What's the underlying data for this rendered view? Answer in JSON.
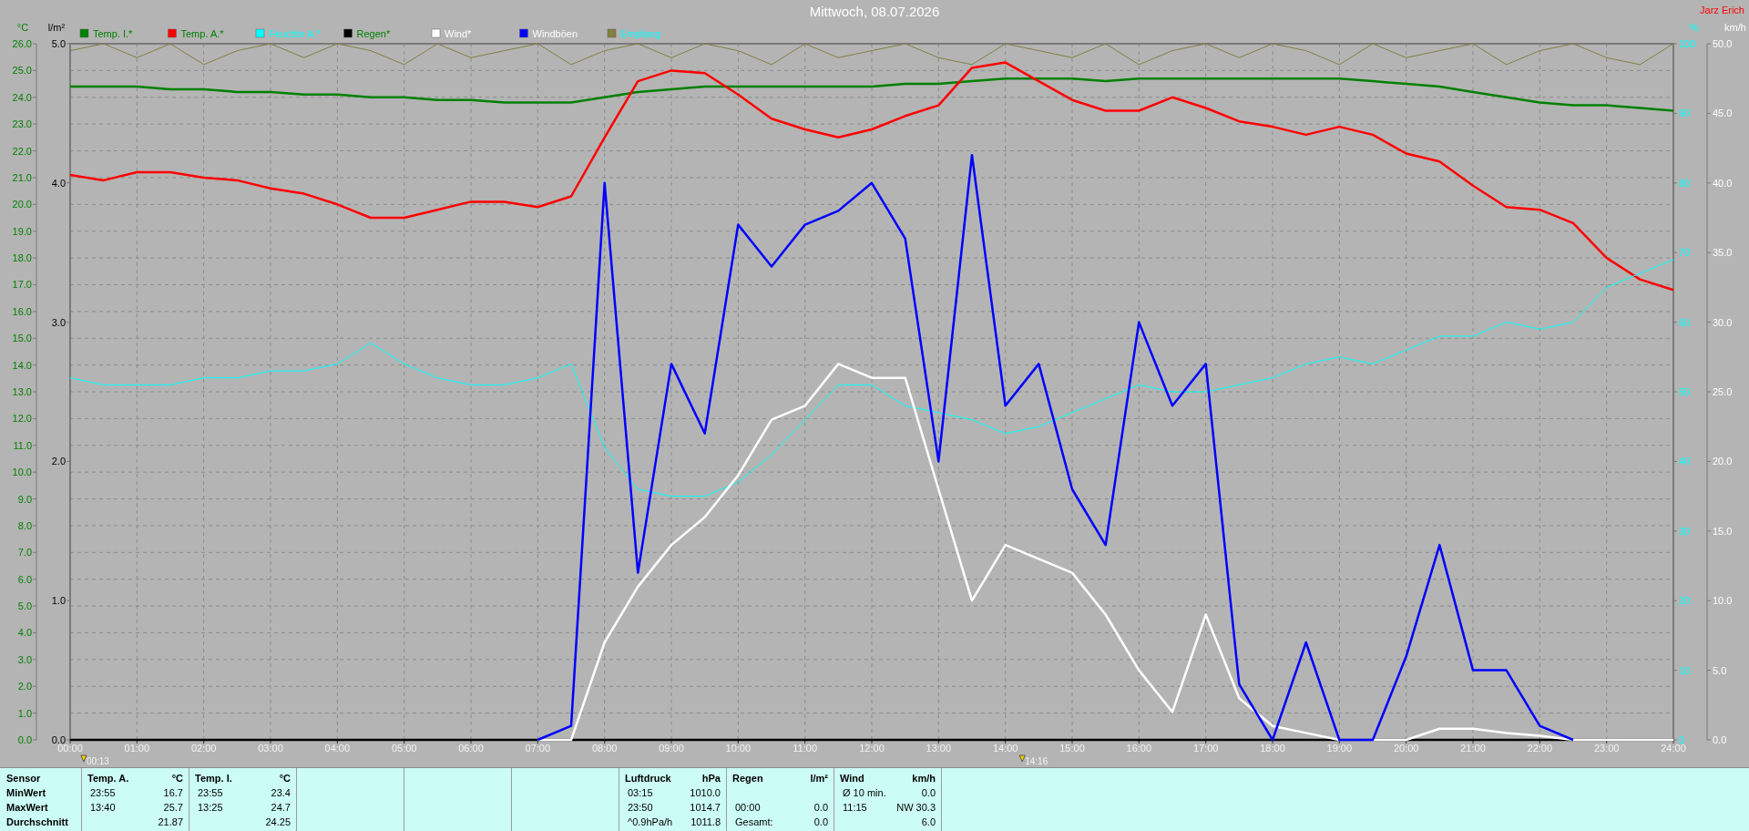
{
  "header": {
    "title": "Mittwoch, 08.07.2026",
    "station": "Jarz Erich"
  },
  "chart": {
    "chart_data": {
      "type": "line",
      "x": [
        0,
        0.5,
        1,
        1.5,
        2,
        2.5,
        3,
        3.5,
        4,
        4.5,
        5,
        5.5,
        6,
        6.5,
        7,
        7.5,
        8,
        8.5,
        9,
        9.5,
        10,
        10.5,
        11,
        11.5,
        12,
        12.5,
        13,
        13.5,
        14,
        14.5,
        15,
        15.5,
        16,
        16.5,
        17,
        17.5,
        18,
        18.5,
        19,
        19.5,
        20,
        20.5,
        21,
        21.5,
        22,
        22.5,
        23,
        23.5,
        24
      ],
      "xlim": [
        0,
        24
      ],
      "grid": true,
      "legend": "top",
      "xticks": [
        {
          "value": 0,
          "label": "00:00"
        },
        {
          "value": 1,
          "label": "01:00"
        },
        {
          "value": 2,
          "label": "02:00"
        },
        {
          "value": 3,
          "label": "03:00"
        },
        {
          "value": 4,
          "label": "04:00"
        },
        {
          "value": 5,
          "label": "05:00"
        },
        {
          "value": 6,
          "label": "06:00"
        },
        {
          "value": 7,
          "label": "07:00"
        },
        {
          "value": 8,
          "label": "08:00"
        },
        {
          "value": 9,
          "label": "09:00"
        },
        {
          "value": 10,
          "label": "10:00"
        },
        {
          "value": 11,
          "label": "11:00"
        },
        {
          "value": 12,
          "label": "12:00"
        },
        {
          "value": 13,
          "label": "13:00"
        },
        {
          "value": 14,
          "label": "14:00"
        },
        {
          "value": 15,
          "label": "15:00"
        },
        {
          "value": 16,
          "label": "16:00"
        },
        {
          "value": 17,
          "label": "17:00"
        },
        {
          "value": 18,
          "label": "18:00"
        },
        {
          "value": 19,
          "label": "19:00"
        },
        {
          "value": 20,
          "label": "20:00"
        },
        {
          "value": 21,
          "label": "21:00"
        },
        {
          "value": 22,
          "label": "22:00"
        },
        {
          "value": 23,
          "label": "23:00"
        },
        {
          "value": 24,
          "label": "24:00"
        }
      ],
      "ylabel": "°C",
      "ylim": [
        0,
        26
      ],
      "yticks": [
        {
          "value": 0,
          "label": "0.0"
        },
        {
          "value": 1,
          "label": "1.0"
        },
        {
          "value": 2,
          "label": "2.0"
        },
        {
          "value": 3,
          "label": "3.0"
        },
        {
          "value": 4,
          "label": "4.0"
        },
        {
          "value": 5,
          "label": "5.0"
        },
        {
          "value": 6,
          "label": "6.0"
        },
        {
          "value": 7,
          "label": "7.0"
        },
        {
          "value": 8,
          "label": "8.0"
        },
        {
          "value": 9,
          "label": "9.0"
        },
        {
          "value": 10,
          "label": "10.0"
        },
        {
          "value": 11,
          "label": "11.0"
        },
        {
          "value": 12,
          "label": "12.0"
        },
        {
          "value": 13,
          "label": "13.0"
        },
        {
          "value": 14,
          "label": "14.0"
        },
        {
          "value": 15,
          "label": "15.0"
        },
        {
          "value": 16,
          "label": "16.0"
        },
        {
          "value": 17,
          "label": "17.0"
        },
        {
          "value": 18,
          "label": "18.0"
        },
        {
          "value": 19,
          "label": "19.0"
        },
        {
          "value": 20,
          "label": "20.0"
        },
        {
          "value": 21,
          "label": "21.0"
        },
        {
          "value": 22,
          "label": "22.0"
        },
        {
          "value": 23,
          "label": "23.0"
        },
        {
          "value": 24,
          "label": "24.0"
        },
        {
          "value": 25,
          "label": "25.0"
        },
        {
          "value": 26,
          "label": "26.0"
        }
      ],
      "y2label": "%",
      "y2lim": [
        0,
        100
      ],
      "y2ticks": [
        {
          "value": 0,
          "label": "0"
        },
        {
          "value": 10,
          "label": "10"
        },
        {
          "value": 20,
          "label": "20"
        },
        {
          "value": 30,
          "label": "30"
        },
        {
          "value": 40,
          "label": "40"
        },
        {
          "value": 50,
          "label": "50"
        },
        {
          "value": 60,
          "label": "60"
        },
        {
          "value": 70,
          "label": "70"
        },
        {
          "value": 80,
          "label": "80"
        },
        {
          "value": 90,
          "label": "90"
        },
        {
          "value": 100,
          "label": "100"
        }
      ],
      "y3label": "km/h",
      "y3lim": [
        0,
        50
      ],
      "y3ticks": [
        {
          "value": 0,
          "label": "0.0"
        },
        {
          "value": 5,
          "label": "5.0"
        },
        {
          "value": 10,
          "label": "10.0"
        },
        {
          "value": 15,
          "label": "15.0"
        },
        {
          "value": 20,
          "label": "20.0"
        },
        {
          "value": 25,
          "label": "25.0"
        },
        {
          "value": 30,
          "label": "30.0"
        },
        {
          "value": 35,
          "label": "35.0"
        },
        {
          "value": 40,
          "label": "40.0"
        },
        {
          "value": 45,
          "label": "45.0"
        },
        {
          "value": 50,
          "label": "50.0"
        }
      ],
      "series": [
        {
          "name": "Temp. I.*",
          "color": "#008000",
          "values": [
            24.4,
            24.4,
            24.4,
            24.3,
            24.3,
            24.2,
            24.2,
            24.1,
            24.1,
            24.0,
            24.0,
            23.9,
            23.9,
            23.8,
            23.8,
            23.8,
            24.0,
            24.2,
            24.3,
            24.4,
            24.4,
            24.4,
            24.4,
            24.4,
            24.4,
            24.5,
            24.5,
            24.6,
            24.7,
            24.7,
            24.7,
            24.6,
            24.7,
            24.7,
            24.7,
            24.7,
            24.7,
            24.7,
            24.7,
            24.6,
            24.5,
            24.4,
            24.2,
            24.0,
            23.8,
            23.7,
            23.7,
            23.6,
            23.5
          ]
        },
        {
          "name": "Temp. A.*",
          "color": "#ff0000",
          "values": [
            21.1,
            20.9,
            21.2,
            21.2,
            21.0,
            20.9,
            20.6,
            20.4,
            20.0,
            19.5,
            19.5,
            19.8,
            20.1,
            20.1,
            19.9,
            20.3,
            22.5,
            24.6,
            25.0,
            24.9,
            24.1,
            23.2,
            22.8,
            22.5,
            22.8,
            23.3,
            23.7,
            25.1,
            25.3,
            24.6,
            23.9,
            23.5,
            23.5,
            24.0,
            23.6,
            23.1,
            22.9,
            22.6,
            22.9,
            22.6,
            21.9,
            21.6,
            20.7,
            19.9,
            19.8,
            19.3,
            18.0,
            17.2,
            16.8
          ]
        },
        {
          "name": "Feuchte A.*",
          "color": "#00ffff",
          "axis": "y2",
          "values": [
            52,
            51,
            51,
            51,
            52,
            52,
            53,
            53,
            54,
            57,
            54,
            52,
            51,
            51,
            52,
            54,
            42,
            36,
            35,
            35,
            37,
            41,
            46,
            51,
            51,
            48,
            47,
            46,
            44,
            45,
            47,
            49,
            51,
            50,
            50,
            51,
            52,
            54,
            55,
            54,
            56,
            58,
            58,
            60,
            59,
            60,
            65,
            67,
            69
          ]
        },
        {
          "name": "Regen*",
          "color": "#000000",
          "values": [
            0,
            0,
            0,
            0,
            0,
            0,
            0,
            0,
            0,
            0,
            0,
            0,
            0,
            0,
            0,
            0,
            0,
            0,
            0,
            0,
            0,
            0,
            0,
            0,
            0,
            0,
            0,
            0,
            0,
            0,
            0,
            0,
            0,
            0,
            0,
            0,
            0,
            0,
            0,
            0,
            0,
            0,
            0,
            0,
            0,
            0,
            0,
            0,
            0
          ]
        },
        {
          "name": "Wind*",
          "color": "#ffffff",
          "axis": "y3",
          "values": [
            null,
            null,
            null,
            null,
            null,
            null,
            null,
            null,
            null,
            null,
            null,
            null,
            null,
            null,
            0,
            0,
            7,
            11,
            14,
            16,
            19,
            23,
            24,
            27,
            26,
            26,
            18,
            10,
            14,
            13,
            12,
            9,
            5,
            2,
            9,
            3,
            1,
            0.5,
            0,
            0,
            0,
            0.8,
            0.8,
            0.5,
            0.3,
            0,
            0,
            0,
            0
          ]
        },
        {
          "name": "Windböen",
          "color": "#0000ff",
          "axis": "y3",
          "values": [
            null,
            null,
            null,
            null,
            null,
            null,
            null,
            null,
            null,
            null,
            null,
            null,
            null,
            null,
            0,
            1,
            40,
            12,
            27,
            22,
            37,
            34,
            37,
            38,
            40,
            36,
            20,
            42,
            24,
            27,
            18,
            14,
            30,
            24,
            27,
            4,
            0,
            7,
            0,
            0,
            6,
            14,
            5,
            5,
            1,
            0,
            null,
            null,
            null
          ]
        },
        {
          "name": "Empfang",
          "color": "#808040",
          "axis": "y2",
          "values": [
            99,
            100,
            98,
            100,
            97,
            99,
            100,
            98,
            100,
            99,
            97,
            100,
            98,
            99,
            100,
            97,
            99,
            100,
            98,
            100,
            99,
            97,
            100,
            98,
            99,
            100,
            98,
            97,
            100,
            99,
            98,
            100,
            97,
            99,
            100,
            98,
            100,
            99,
            97,
            100,
            98,
            99,
            100,
            97,
            99,
            100,
            98,
            97,
            100
          ]
        }
      ]
    },
    "rain_axis": {
      "unit": "l/m²",
      "ticks": [
        "5.0",
        "4.0",
        "3.0",
        "2.0",
        "1.0",
        "0.0"
      ]
    },
    "markers": [
      {
        "time": "00:13"
      },
      {
        "time": "14:16"
      }
    ]
  },
  "table": {
    "row_labels": [
      "Sensor",
      "MinWert",
      "MaxWert",
      "Durchschnitt"
    ],
    "groups": [
      {
        "kind": "values",
        "title": "Temp. A.",
        "unit": "°C",
        "rows": [
          {
            "time": "23:55",
            "value": "16.7"
          },
          {
            "time": "13:40",
            "value": "25.7"
          },
          {
            "value": "21.87"
          }
        ]
      },
      {
        "kind": "values",
        "title": "Temp. I.",
        "unit": "°C",
        "rows": [
          {
            "time": "23:55",
            "value": "23.4"
          },
          {
            "time": "13:25",
            "value": "24.7"
          },
          {
            "value": "24.25"
          }
        ]
      },
      {
        "kind": "blank"
      },
      {
        "kind": "blank"
      },
      {
        "kind": "blank"
      },
      {
        "kind": "values",
        "title": "Luftdruck",
        "unit": "hPa",
        "rows": [
          {
            "time": "03:15",
            "value": "1010.0"
          },
          {
            "time": "23:50",
            "value": "1014.7"
          },
          {
            "time": "^0.9hPa/h",
            "value": "1011.8"
          }
        ]
      },
      {
        "kind": "values",
        "title": "Regen",
        "unit": "l/m²",
        "rows": [
          {},
          {
            "time": "00:00",
            "value": "0.0"
          },
          {
            "time": "Gesamt:",
            "value": "0.0"
          }
        ]
      },
      {
        "kind": "values",
        "title": "Wind",
        "unit": "km/h",
        "rows": [
          {
            "time": "Ø 10 min.",
            "value": "0.0"
          },
          {
            "time": "11:15",
            "value": "NW 30.3"
          },
          {
            "value": "6.0"
          }
        ]
      }
    ]
  }
}
